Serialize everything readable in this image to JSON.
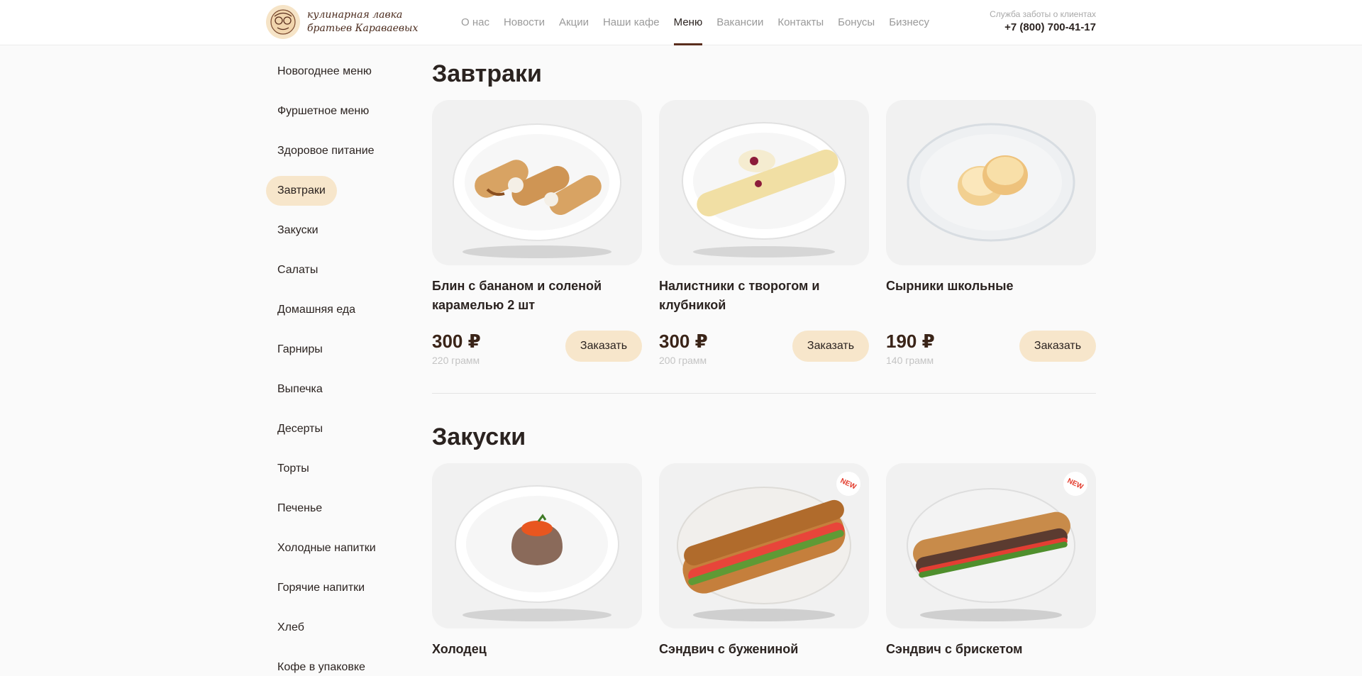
{
  "header": {
    "logo": {
      "line1": "кулинарная лавка",
      "line2": "братьев Караваевых"
    },
    "nav": [
      {
        "label": "О нас",
        "active": false
      },
      {
        "label": "Новости",
        "active": false
      },
      {
        "label": "Акции",
        "active": false
      },
      {
        "label": "Наши кафе",
        "active": false
      },
      {
        "label": "Меню",
        "active": true
      },
      {
        "label": "Вакансии",
        "active": false
      },
      {
        "label": "Контакты",
        "active": false
      },
      {
        "label": "Бонусы",
        "active": false
      },
      {
        "label": "Бизнесу",
        "active": false
      }
    ],
    "support": {
      "label": "Служба заботы о клиентах",
      "phone": "+7 (800) 700-41-17"
    }
  },
  "sidebar": {
    "items": [
      {
        "label": "Новогоднее меню"
      },
      {
        "label": "Фуршетное меню"
      },
      {
        "label": "Здоровое питание"
      },
      {
        "label": "Завтраки",
        "active": true
      },
      {
        "label": "Закуски"
      },
      {
        "label": "Салаты"
      },
      {
        "label": "Домашняя еда"
      },
      {
        "label": "Гарниры"
      },
      {
        "label": "Выпечка"
      },
      {
        "label": "Десерты"
      },
      {
        "label": "Торты"
      },
      {
        "label": "Печенье"
      },
      {
        "label": "Холодные напитки"
      },
      {
        "label": "Горячие напитки"
      },
      {
        "label": "Хлеб"
      },
      {
        "label": "Кофе в упаковке"
      }
    ]
  },
  "sections": [
    {
      "title": "Завтраки",
      "products": [
        {
          "name": "Блин с бананом и соленой карамелью 2 шт",
          "price": "300 ₽",
          "weight": "220 грамм",
          "button": "Заказать",
          "image": "pancake-rolls"
        },
        {
          "name": "Налистники с творогом и клубникой",
          "price": "300 ₽",
          "weight": "200 грамм",
          "button": "Заказать",
          "image": "crepe-roll"
        },
        {
          "name": "Сырники школьные",
          "price": "190 ₽",
          "weight": "140 грамм",
          "button": "Заказать",
          "image": "syrniki"
        }
      ]
    },
    {
      "title": "Закуски",
      "products": [
        {
          "name": "Холодец",
          "image": "aspic"
        },
        {
          "name": "Сэндвич с бужениной",
          "badge": "NEW",
          "image": "sandwich"
        },
        {
          "name": "Сэндвич с брискетом",
          "badge": "NEW",
          "image": "sandwich"
        }
      ]
    }
  ],
  "colors": {
    "accent": "#f7e6cb",
    "brand_dark": "#5a2e1d",
    "badge_red": "#e33b2c"
  }
}
